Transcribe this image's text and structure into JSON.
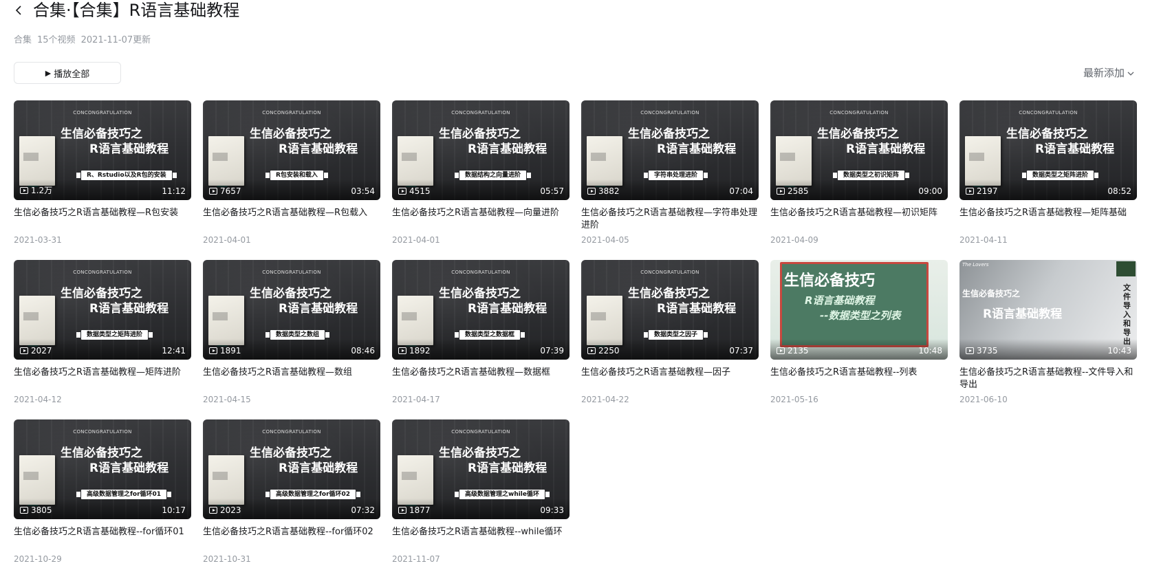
{
  "header": {
    "title": "合集·【合集】R语言基础教程"
  },
  "meta": {
    "kind": "合集",
    "count": "15个视频",
    "updated": "2021-11-07更新"
  },
  "toolbar": {
    "play_all_label": "播放全部",
    "sort_label": "最新添加"
  },
  "thumb_text": {
    "banner": "CONCONGRATULATION",
    "line1": "生信必备技巧之",
    "line2": "R语言基础教程"
  },
  "videos": [
    {
      "title": "生信必备技巧之R语言基础教程—R包安装",
      "views": "1.2万",
      "duration": "11:12",
      "date": "2021-03-31",
      "tag": "R、Rstudio以及R包的安装",
      "style": "dark"
    },
    {
      "title": "生信必备技巧之R语言基础教程—R包载入",
      "views": "7657",
      "duration": "03:54",
      "date": "2021-04-01",
      "tag": "R包安装和载入",
      "style": "dark"
    },
    {
      "title": "生信必备技巧之R语言基础教程—向量进阶",
      "views": "4515",
      "duration": "05:57",
      "date": "2021-04-01",
      "tag": "数据结构之向量进阶",
      "style": "dark"
    },
    {
      "title": "生信必备技巧之R语言基础教程—字符串处理进阶",
      "views": "3882",
      "duration": "07:04",
      "date": "2021-04-05",
      "tag": "字符串处理进阶",
      "style": "dark"
    },
    {
      "title": "生信必备技巧之R语言基础教程—初识矩阵",
      "views": "2585",
      "duration": "09:00",
      "date": "2021-04-09",
      "tag": "数据类型之初识矩阵",
      "style": "dark"
    },
    {
      "title": "生信必备技巧之R语言基础教程—矩阵基础",
      "views": "2197",
      "duration": "08:52",
      "date": "2021-04-11",
      "tag": "数据类型之矩阵进阶",
      "style": "dark"
    },
    {
      "title": "生信必备技巧之R语言基础教程—矩阵进阶",
      "views": "2027",
      "duration": "12:41",
      "date": "2021-04-12",
      "tag": "数据类型之矩阵进阶",
      "style": "dark"
    },
    {
      "title": "生信必备技巧之R语言基础教程—数组",
      "views": "1891",
      "duration": "08:46",
      "date": "2021-04-15",
      "tag": "数据类型之数组",
      "style": "dark"
    },
    {
      "title": "生信必备技巧之R语言基础教程—数据框",
      "views": "1892",
      "duration": "07:39",
      "date": "2021-04-17",
      "tag": "数据类型之数据框",
      "style": "dark"
    },
    {
      "title": "生信必备技巧之R语言基础教程—因子",
      "views": "2250",
      "duration": "07:37",
      "date": "2021-04-22",
      "tag": "数据类型之因子",
      "style": "dark"
    },
    {
      "title": "生信必备技巧之R语言基础教程--列表",
      "views": "2135",
      "duration": "10:48",
      "date": "2021-05-16",
      "style": "green",
      "g1": "生信必备技巧",
      "g2": "R语言基础教程",
      "g3": "--数据类型之列表"
    },
    {
      "title": "生信必备技巧之R语言基础教程--文件导入和导出",
      "views": "3735",
      "duration": "10:43",
      "date": "2021-06-10",
      "style": "office",
      "o1": "生信必备技巧之",
      "o2": "R语言基础教程",
      "o3": "文件导入和导出",
      "o4": "The Lovers"
    },
    {
      "title": "生信必备技巧之R语言基础教程--for循环01",
      "views": "3805",
      "duration": "10:17",
      "date": "2021-10-29",
      "tag": "高级数据管理之for循环01",
      "style": "dark"
    },
    {
      "title": "生信必备技巧之R语言基础教程--for循环02",
      "views": "2023",
      "duration": "07:32",
      "date": "2021-10-31",
      "tag": "高级数据管理之for循环02",
      "style": "dark"
    },
    {
      "title": "生信必备技巧之R语言基础教程--while循环",
      "views": "1877",
      "duration": "09:33",
      "date": "2021-11-07",
      "tag": "高级数据管理之while循环",
      "style": "dark"
    }
  ],
  "colors": {
    "text": "#18191c",
    "muted": "#9499a0",
    "border": "#e3e5e7"
  }
}
